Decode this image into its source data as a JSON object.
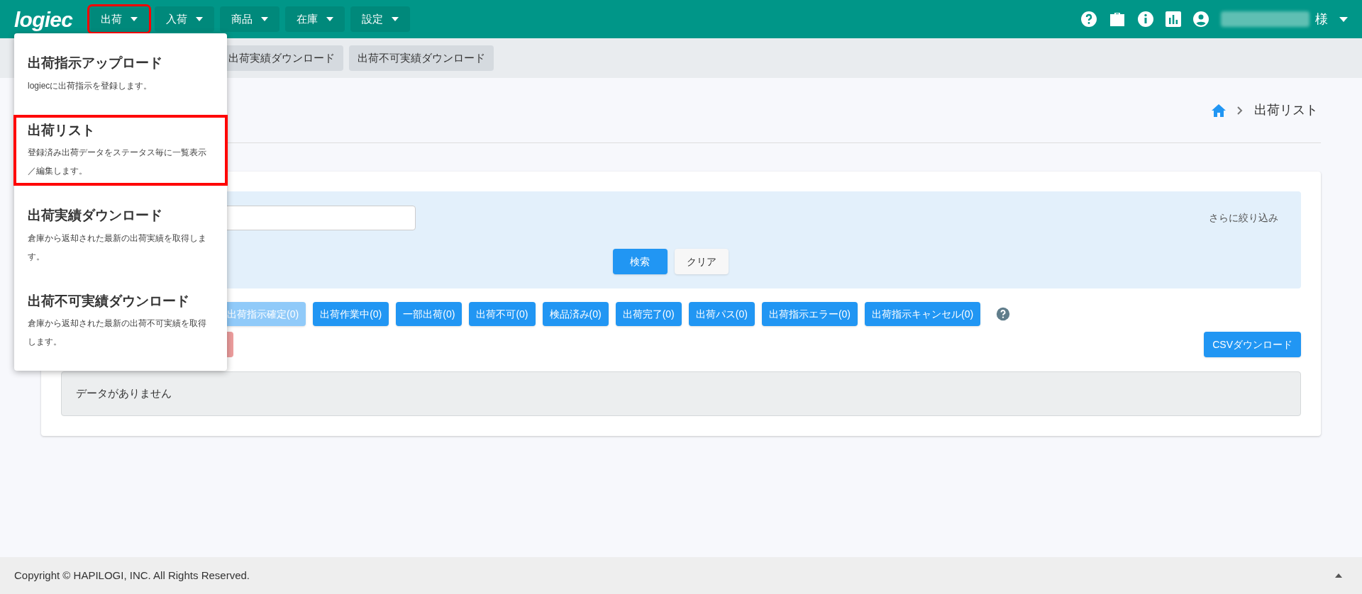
{
  "header": {
    "logo": "logiec",
    "nav": [
      {
        "label": "出荷",
        "selected": true
      },
      {
        "label": "入荷",
        "selected": false
      },
      {
        "label": "商品",
        "selected": false
      },
      {
        "label": "在庫",
        "selected": false
      },
      {
        "label": "設定",
        "selected": false
      }
    ],
    "user_suffix": "様"
  },
  "subnav": [
    "出荷実績ダウンロード",
    "出荷不可実績ダウンロード"
  ],
  "dropdown": [
    {
      "title": "出荷指示アップロード",
      "description": "logiecに出荷指示を登録します。",
      "selected": false
    },
    {
      "title": "出荷リスト",
      "description": "登録済み出荷データをステータス毎に一覧表示／編集します。",
      "selected": true
    },
    {
      "title": "出荷実績ダウンロード",
      "description": "倉庫から返却された最新の出荷実績を取得します。",
      "selected": false
    },
    {
      "title": "出荷不可実績ダウンロード",
      "description": "倉庫から返却された最新の出荷不可実績を取得します。",
      "selected": false
    }
  ],
  "breadcrumb": "出荷リスト",
  "search": {
    "filter_link": "さらに絞り込み",
    "search_button": "検索",
    "clear_button": "クリア"
  },
  "status_tabs": [
    {
      "label": "出荷指示確定(0)",
      "selected": true
    },
    {
      "label": "出荷作業中(0)",
      "selected": false
    },
    {
      "label": "一部出荷(0)",
      "selected": false
    },
    {
      "label": "出荷不可(0)",
      "selected": false
    },
    {
      "label": "検品済み(0)",
      "selected": false
    },
    {
      "label": "出荷完了(0)",
      "selected": false
    },
    {
      "label": "出荷パス(0)",
      "selected": false
    },
    {
      "label": "出荷指示エラー(0)",
      "selected": false
    },
    {
      "label": "出荷指示キャンセル(0)",
      "selected": false
    }
  ],
  "csv_button": "CSVダウンロード",
  "empty_message": "データがありません",
  "footer": "Copyright © HAPILOGI, INC. All Rights Reserved."
}
